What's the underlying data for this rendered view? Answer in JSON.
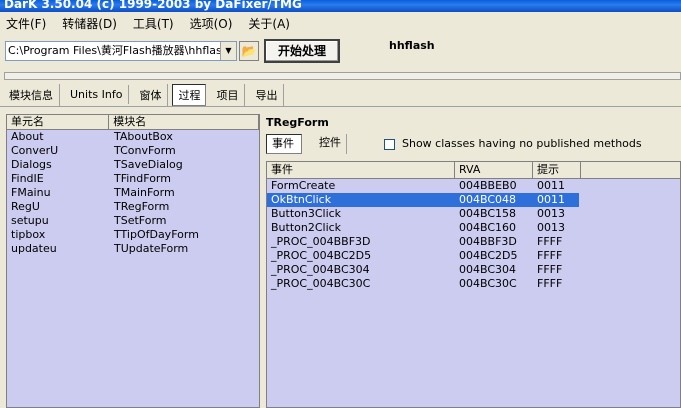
{
  "window": {
    "title": "DarK 3.50.04 (c) 1999-2003 by DaFixer/TMG"
  },
  "menu": [
    "文件(F)",
    "转储器(D)",
    "工具(T)",
    "选项(O)",
    "关于(A)"
  ],
  "toolbar": {
    "path_value": "C:\\Program Files\\黄河Flash播放器\\hhflash.e",
    "start_label": "开始处理",
    "app_label": "hhflash"
  },
  "tabs": [
    "模块信息",
    "Units Info",
    "窗体",
    "过程",
    "项目",
    "导出"
  ],
  "active_tab": "过程",
  "units": {
    "headers": [
      "单元名",
      "模块名"
    ],
    "rows": [
      [
        "About",
        "TAboutBox"
      ],
      [
        "ConverU",
        "TConvForm"
      ],
      [
        "Dialogs",
        "TSaveDialog"
      ],
      [
        "FindIE",
        "TFindForm"
      ],
      [
        "FMainu",
        "TMainForm"
      ],
      [
        "RegU",
        "TRegForm"
      ],
      [
        "setupu",
        "TSetForm"
      ],
      [
        "tipbox",
        "TTipOfDayForm"
      ],
      [
        "updateu",
        "TUpdateForm"
      ]
    ]
  },
  "detail": {
    "form_name": "TRegForm",
    "subtabs": [
      "事件",
      "控件"
    ],
    "checkbox_label": "Show classes having no published methods",
    "headers": [
      "事件",
      "RVA",
      "提示"
    ],
    "rows": [
      [
        "FormCreate",
        "004BBEB0",
        "0011"
      ],
      [
        "OkBtnClick",
        "004BC048",
        "0011"
      ],
      [
        "Button3Click",
        "004BC158",
        "0013"
      ],
      [
        "Button2Click",
        "004BC160",
        "0013"
      ],
      [
        "_PROC_004BBF3D",
        "004BBF3D",
        "FFFF"
      ],
      [
        "_PROC_004BC2D5",
        "004BC2D5",
        "FFFF"
      ],
      [
        "_PROC_004BC304",
        "004BC304",
        "FFFF"
      ],
      [
        "_PROC_004BC30C",
        "004BC30C",
        "FFFF"
      ]
    ],
    "selected_row": 1
  },
  "colors": {
    "panel_bg": "#ccccf0",
    "selection": "#2f6fd9",
    "chrome": "#ece9d8"
  }
}
